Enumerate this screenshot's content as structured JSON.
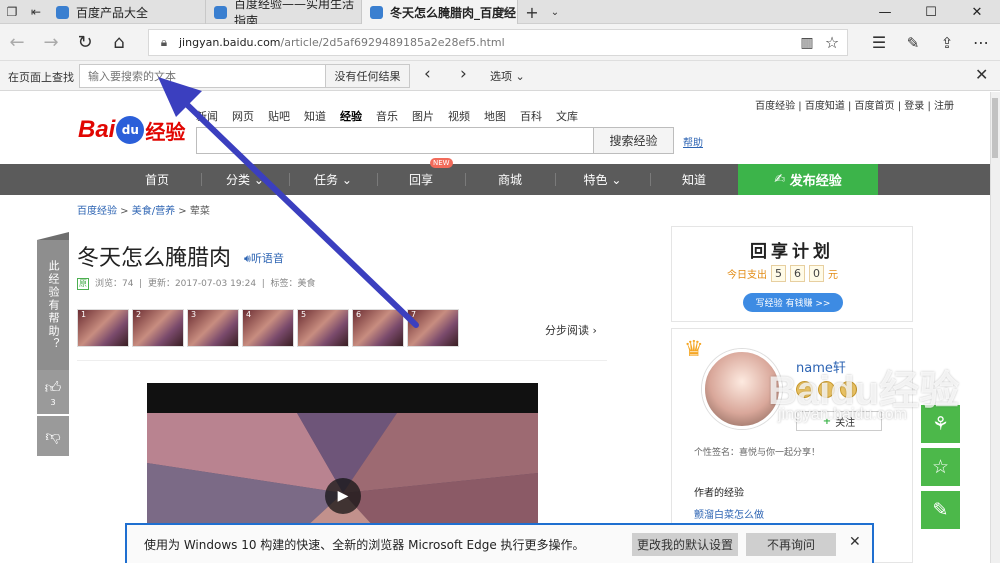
{
  "tabs": [
    {
      "title": "百度产品大全"
    },
    {
      "title": "百度经验——实用生活指南"
    },
    {
      "title": "冬天怎么腌腊肉_百度经"
    }
  ],
  "address": {
    "host": "jingyan.baidu.com",
    "path": "/article/2d5af6929489185a2e28ef5.html"
  },
  "findbar": {
    "label": "在页面上查找",
    "placeholder": "输入要搜索的文本",
    "result": "没有任何结果",
    "options": "选项"
  },
  "site": {
    "toplinks": "百度经验 | 百度知道 | 百度首页 | 登录 | 注册",
    "logo_bai": "Bai",
    "logo_du": "du",
    "logo_jy": "经验",
    "search_tabs": [
      "新闻",
      "网页",
      "贴吧",
      "知道",
      "经验",
      "音乐",
      "图片",
      "视频",
      "地图",
      "百科",
      "文库"
    ],
    "search_button": "搜索经验",
    "help": "帮助",
    "nav": [
      "首页",
      "分类",
      "任务",
      "回享",
      "商城",
      "特色",
      "知道"
    ],
    "nav_new": "NEW",
    "publish": "发布经验"
  },
  "article": {
    "breadcrumb": [
      "百度经验",
      "美食/营养",
      "荤菜"
    ],
    "title": "冬天怎么腌腊肉",
    "listen": "听语音",
    "original_badge": "原",
    "views": "浏览：74",
    "updated": "更新：2017-07-03 19:24",
    "tags": "标签：美食",
    "step_numbers": [
      "1",
      "2",
      "3",
      "4",
      "5",
      "6",
      "7"
    ],
    "step_read": "分步阅读"
  },
  "sidebar": {
    "plan_title": "回享计划",
    "plan_today": "今日支出",
    "plan_digits": [
      "5",
      "6",
      "0"
    ],
    "plan_unit": "元",
    "plan_button": "写经验 有钱赚 >>",
    "username": "name轩",
    "follow": "关注",
    "signature": "个性签名：喜悦与你一起分享！",
    "author_exp": "作者的经验",
    "exp_link": "颤溜白菜怎么做"
  },
  "helpful": {
    "label": "此经验有帮助？",
    "like_count": "3"
  },
  "watermark": {
    "text": "Baidu经验",
    "url": "jingyan.baidu.com"
  },
  "notification": {
    "text": "使用为 Windows 10 构建的快速、全新的浏览器 Microsoft Edge 执行更多操作。",
    "change_default": "更改我的默认设置",
    "dont_ask": "不再询问"
  },
  "colors": {
    "accent_blue": "#2d64b3",
    "publish_green": "#3cb44a",
    "arrow": "#3b3fbf"
  }
}
